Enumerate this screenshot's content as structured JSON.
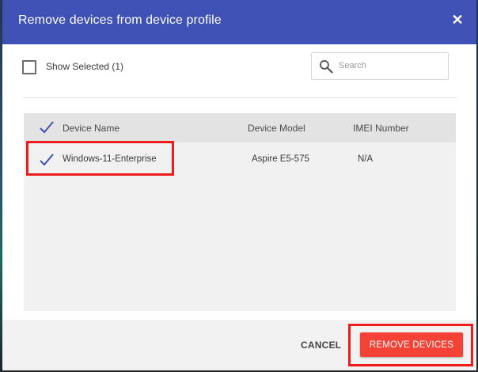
{
  "dialog": {
    "title": "Remove devices from device profile",
    "close_icon": "close-icon",
    "show_selected_label": "Show Selected (1)",
    "show_selected_checked": false,
    "search": {
      "placeholder": "Search",
      "value": "",
      "icon": "search-icon"
    }
  },
  "table": {
    "select_all_icon": "check-icon",
    "columns": [
      "Device Name",
      "Device Model",
      "IMEI Number"
    ],
    "rows": [
      {
        "selected": true,
        "name": "Windows-11-Enterprise",
        "model": "Aspire E5-575",
        "imei": "N/A"
      }
    ]
  },
  "footer": {
    "cancel_label": "CANCEL",
    "remove_label": "REMOVE DEVICES"
  },
  "colors": {
    "header": "#3f51b5",
    "primary_button": "#f44336",
    "highlight": "#ee1c1c",
    "check": "#3f51b5"
  }
}
